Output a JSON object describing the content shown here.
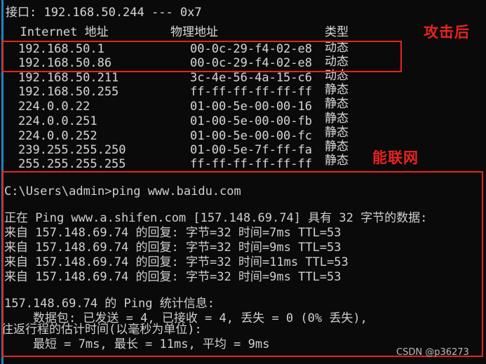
{
  "window": {
    "type": "windows-command-prompt",
    "background_color": "#0a0a0a",
    "text_color": "#cccccc",
    "annotation_color": "#e8231f"
  },
  "arp_output": {
    "interface_line": "接口: 192.168.50.244 --- 0x7",
    "headers": {
      "internet_address": "  Internet 地址",
      "physical_address": "物理地址",
      "type": "类型"
    },
    "rows": [
      {
        "ip": "192.168.50.1",
        "mac": "00-0c-29-f4-02-e8",
        "type": "动态"
      },
      {
        "ip": "192.168.50.86",
        "mac": "00-0c-29-f4-02-e8",
        "type": "动态"
      },
      {
        "ip": "192.168.50.211",
        "mac": "3c-4e-56-4a-15-c6",
        "type": "动态"
      },
      {
        "ip": "192.168.50.255",
        "mac": "ff-ff-ff-ff-ff-ff",
        "type": "静态"
      },
      {
        "ip": "224.0.0.22",
        "mac": "01-00-5e-00-00-16",
        "type": "静态"
      },
      {
        "ip": "224.0.0.251",
        "mac": "01-00-5e-00-00-fb",
        "type": "静态"
      },
      {
        "ip": "224.0.0.252",
        "mac": "01-00-5e-00-00-fc",
        "type": "静态"
      },
      {
        "ip": "239.255.255.250",
        "mac": "01-00-5e-7f-ff-fa",
        "type": "静态"
      },
      {
        "ip": "255.255.255.255",
        "mac": "ff-ff-ff-ff-ff-ff",
        "type": "静态"
      }
    ]
  },
  "ping_output": {
    "prompt_line": "C:\\Users\\admin>ping www.baidu.com",
    "starting_line": "正在 Ping www.a.shifen.com [157.148.69.74] 具有 32 字节的数据:",
    "replies": [
      "来自 157.148.69.74 的回复: 字节=32 时间=7ms TTL=53",
      "来自 157.148.69.74 的回复: 字节=32 时间=9ms TTL=53",
      "来自 157.148.69.74 的回复: 字节=32 时间=11ms TTL=53",
      "来自 157.148.69.74 的回复: 字节=32 时间=9ms TTL=53"
    ],
    "stats_header": "157.148.69.74 的 Ping 统计信息:",
    "stats_packets": "    数据包: 已发送 = 4, 已接收 = 4, 丢失 = 0 (0% 丢失),",
    "rtt_header": "往返行程的估计时间(以毫秒为单位):",
    "rtt_values": "    最短 = 7ms, 最长 = 11ms, 平均 = 9ms"
  },
  "annotations": {
    "after_attack_label": "攻击后",
    "can_connect_label": "能联网",
    "watermark": "CSDN @p36273"
  }
}
